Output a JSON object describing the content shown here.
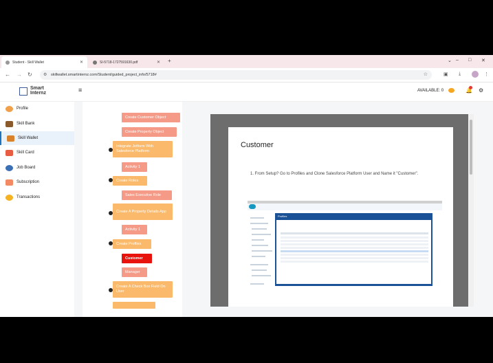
{
  "browser": {
    "tabs": [
      {
        "title": "Student - Skill Wallet",
        "active": true
      },
      {
        "title": "SI-5718-1727591630.pdf",
        "active": false
      }
    ],
    "url": "skillwallet.smartinternz.com/Student/guided_project_info/5718#"
  },
  "header": {
    "logo_line1": "Smart",
    "logo_line2": "Internz",
    "available_label": "AVAILABLE: 0"
  },
  "sidebar": {
    "items": [
      {
        "label": "Profile",
        "icon": "profile-icon",
        "color": "#f0a04b"
      },
      {
        "label": "Skill Bank",
        "icon": "bank-icon",
        "color": "#8b5a2b"
      },
      {
        "label": "Skill Wallet",
        "icon": "wallet-icon",
        "color": "#d9822b",
        "active": true
      },
      {
        "label": "Skill Card",
        "icon": "card-icon",
        "color": "#e85c41"
      },
      {
        "label": "Job Board",
        "icon": "job-icon",
        "color": "#3b6fb6"
      },
      {
        "label": "Subscription",
        "icon": "subscription-icon",
        "color": "#f48a63"
      },
      {
        "label": "Transactions",
        "icon": "coins-icon",
        "color": "#f5b324"
      }
    ]
  },
  "tree": {
    "items": [
      {
        "label": "Create Customer Object",
        "style": "salmon"
      },
      {
        "label": "Create Property Object",
        "style": "salmon"
      },
      {
        "label": "Integrate Jotform With Salesforce Platform",
        "style": "peach"
      },
      {
        "label": "Activity 1",
        "style": "salmon"
      },
      {
        "label": "Create Roles",
        "style": "peach"
      },
      {
        "label": "Sales Executive Role",
        "style": "salmon"
      },
      {
        "label": "Create A Property Details App",
        "style": "peach"
      },
      {
        "label": "Activity 1",
        "style": "salmon"
      },
      {
        "label": "Create Profiles",
        "style": "peach"
      },
      {
        "label": "Customer",
        "style": "red"
      },
      {
        "label": "Manager",
        "style": "salmon"
      },
      {
        "label": "Create A Check Box Field On User",
        "style": "peach"
      }
    ]
  },
  "document": {
    "heading": "Customer",
    "step1": "1.  From Setup? Go to Profiles and Clone Salesforce Platform User and Name it \"Customer\".",
    "embedded_title": "Profiles"
  },
  "colors": {
    "salmon": "#f59a86",
    "peach": "#fbb96b",
    "selected": "#e8130c",
    "accent": "#1e73be"
  }
}
